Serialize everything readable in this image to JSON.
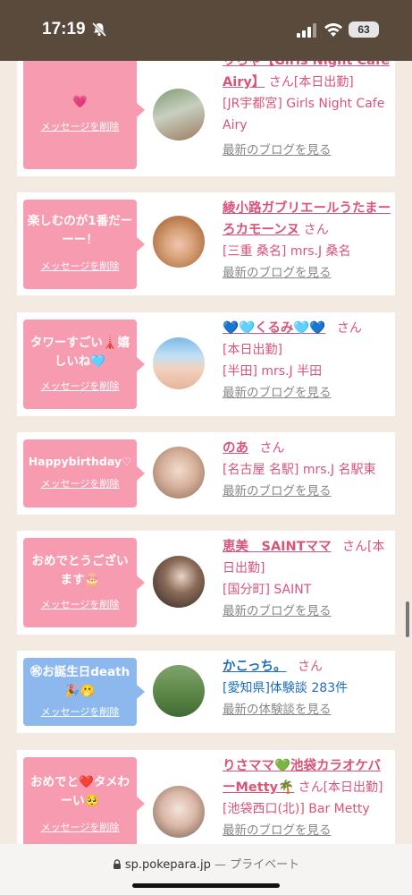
{
  "status_bar": {
    "time": "17:19",
    "battery": "63",
    "icons": [
      "bell-slash-icon",
      "signal-icon",
      "wifi-icon",
      "battery-icon"
    ]
  },
  "messages": [
    {
      "bubble_text": "💗",
      "bubble_color": "pink",
      "delete_label": "メッセージを削除",
      "name": "りちゃ【Girls Night Cafe Airy】",
      "san": "さん",
      "status": "[本日出勤]",
      "shop": "[JR宇都宮] Girls Night Cafe Airy",
      "link": "最新のブログを見る"
    },
    {
      "bubble_text": "楽しむのが1番だーーー！",
      "bubble_color": "pink",
      "delete_label": "メッセージを削除",
      "name": "綾小路ガブリエールうたまーろカモーンヌ",
      "san": "さん",
      "shop": "[三重 桑名] mrs.J 桑名",
      "link": "最新のブログを見る"
    },
    {
      "bubble_text": "タワーすごい🗼嬉しいね🩵",
      "bubble_color": "pink",
      "delete_label": "メッセージを削除",
      "name": "💙🩵くるみ🩵💙",
      "san": "さん",
      "status": "[本日出勤]",
      "shop": "[半田] mrs.J 半田",
      "link": "最新のブログを見る"
    },
    {
      "bubble_text": "Happybirthday♡",
      "bubble_color": "pink",
      "delete_label": "メッセージを削除",
      "name": "のあ",
      "san": "さん",
      "shop": "[名古屋 名駅] mrs.J 名駅東",
      "link": "最新のブログを見る"
    },
    {
      "bubble_text": "おめでとうございます🎂",
      "bubble_color": "pink",
      "delete_label": "メッセージを削除",
      "name": "恵美　SAINTママ",
      "san": "さん",
      "status": "[本日出勤]",
      "shop": "[国分町] SAINT",
      "link": "最新のブログを見る"
    },
    {
      "bubble_text": "㊗お誕生日death🎉🫢",
      "bubble_color": "blue",
      "delete_label": "メッセージを削除",
      "name": "かこっち。",
      "san": "さん",
      "shop": "[愛知県]体験談 283件",
      "link": "最新の体験談を見る"
    },
    {
      "bubble_text": "おめでと❤️タメわーい🥺",
      "bubble_color": "pink",
      "delete_label": "メッセージを削除",
      "name": "りさママ💚池袋カラオケバーMetty🌴",
      "san": "さん",
      "status": "[本日出勤]",
      "shop": "[池袋西口(北)] Bar Metty",
      "link": "最新のブログを見る"
    }
  ],
  "url_bar": {
    "domain": "sp.pokepara.jp",
    "separator": "—",
    "mode": "プライベート"
  },
  "colors": {
    "status_bg": "#5a4a3b",
    "page_bg": "#f3ebe2",
    "bubble_pink": "#f79bb0",
    "bubble_blue": "#8db8ee",
    "name_pink": "#d6557a",
    "name_blue": "#1e6fb8"
  }
}
